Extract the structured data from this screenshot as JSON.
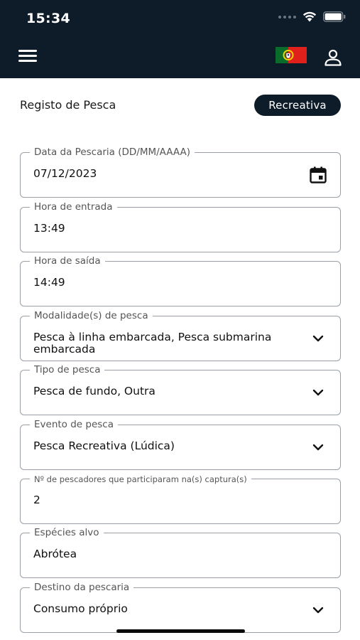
{
  "status_bar": {
    "time": "15:34"
  },
  "header": {
    "menu_icon": "hamburger-menu-icon",
    "flag": "portugal-flag",
    "profile_icon": "user-icon"
  },
  "page": {
    "title": "Registo de Pesca",
    "badge": "Recreativa"
  },
  "colors": {
    "header_bg": "#0e1c2a",
    "badge_bg": "#0e1c2a",
    "border": "#9aa0a6"
  },
  "fields": [
    {
      "label": "Data da Pescaria (DD/MM/AAAA)",
      "value": "07/12/2023",
      "icon": "calendar-icon"
    },
    {
      "label": "Hora de entrada",
      "value": "13:49"
    },
    {
      "label": "Hora de saída",
      "value": "14:49"
    },
    {
      "label": "Modalidade(s) de pesca",
      "value": "Pesca à linha embarcada, Pesca submarina embarcada",
      "icon": "chevron-down-icon"
    },
    {
      "label": "Tipo de pesca",
      "value": "Pesca de fundo, Outra",
      "icon": "chevron-down-icon"
    },
    {
      "label": "Evento de pesca",
      "value": "Pesca Recreativa (Lúdica)",
      "icon": "chevron-down-icon"
    },
    {
      "label": "Nº de pescadores que participaram na(s) captura(s)",
      "value": "2"
    },
    {
      "label": "Espécies alvo",
      "value": "Abrótea"
    },
    {
      "label": "Destino da pescaria",
      "value": "Consumo próprio",
      "icon": "chevron-down-icon"
    }
  ]
}
